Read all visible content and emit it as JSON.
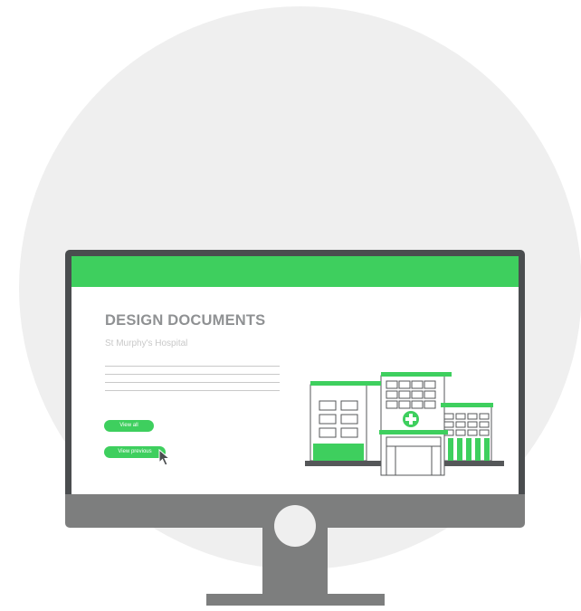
{
  "colors": {
    "accent": "#3ecf5e",
    "bezel": "#4a4d4f",
    "stand": "#7d7e7e",
    "background_circle": "#efefef",
    "title_text": "#8f9193",
    "muted_text": "#c9c9c9",
    "illustration_line": "#555759"
  },
  "document": {
    "title": "DESIGN DOCUMENTS",
    "subtitle": "St Murphy's Hospital"
  },
  "buttons": {
    "view_all": "View all",
    "view_previous": "View previous"
  },
  "icons": {
    "cursor": "arrow-cursor-icon",
    "illustration": "hospital-buildings-icon"
  }
}
